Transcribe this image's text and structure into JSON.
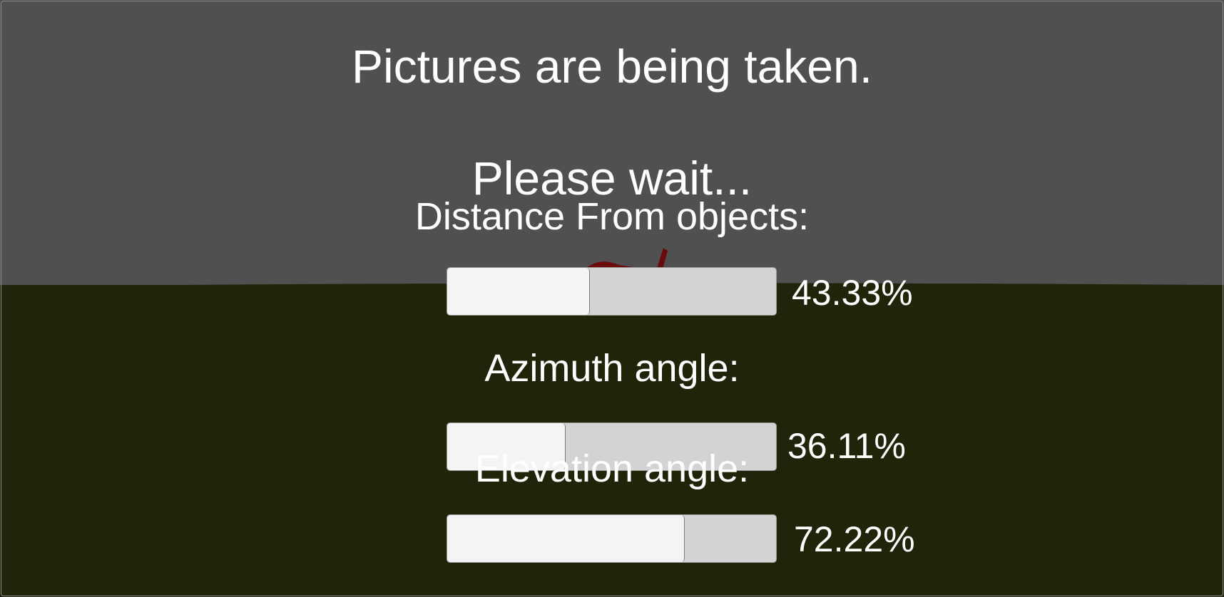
{
  "window": {
    "title": "Pictures are being taken.",
    "subtitle": "Please wait..."
  },
  "colors": {
    "sky": "#505050",
    "ground": "#1e2509",
    "text": "#ffffff",
    "slider_track": "#d3d3d3",
    "slider_fill": "#f4f4f4",
    "object": "#6b0a0a"
  },
  "sliders": [
    {
      "label": "Distance From objects:",
      "value_text": "43.33%",
      "fraction": 0.4333
    },
    {
      "label": "Azimuth angle:",
      "value_text": "36.11%",
      "fraction": 0.3611
    },
    {
      "label": "Elevation angle:",
      "value_text": "72.22%",
      "fraction": 0.7222
    }
  ]
}
